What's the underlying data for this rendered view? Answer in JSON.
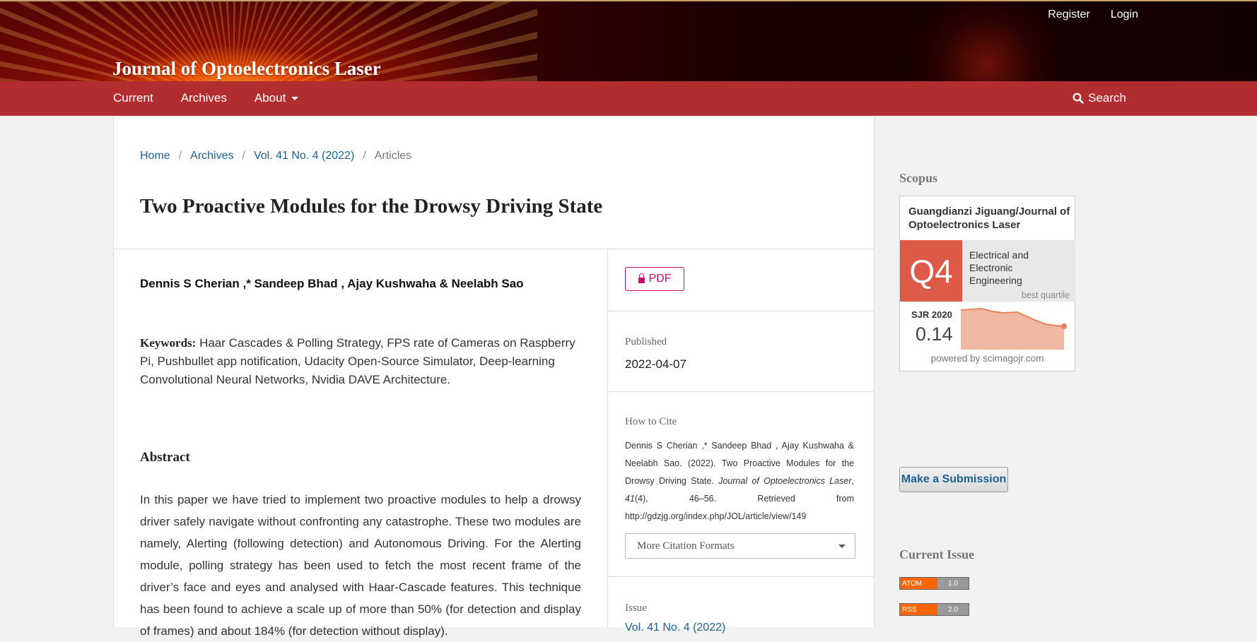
{
  "header": {
    "site_title": "Journal of Optoelectronics Laser",
    "user_nav": {
      "register": "Register",
      "login": "Login"
    }
  },
  "nav": {
    "items": [
      {
        "label": "Current"
      },
      {
        "label": "Archives"
      },
      {
        "label": "About"
      }
    ],
    "search": "Search"
  },
  "breadcrumb": {
    "home": "Home",
    "archives": "Archives",
    "issue": "Vol. 41 No. 4 (2022)",
    "current": "Articles",
    "separator": "/"
  },
  "article": {
    "title": "Two Proactive Modules for the Drowsy Driving State",
    "authors": "Dennis S Cherian ,* Sandeep Bhad , Ajay Kushwaha & Neelabh Sao",
    "keywords_label": "Keywords:",
    "keywords": "Haar Cascades & Polling Strategy, FPS rate of Cameras on Raspberry Pi, Pushbullet app notification, Udacity Open-Source Simulator, Deep-learning Convolutional Neural Networks, Nvidia DAVE Architecture.",
    "abstract_heading": "Abstract",
    "abstract": "In this paper we have tried to implement two proactive modules to help a drowsy driver safely navigate without confronting any catastrophe. These two modules are namely, Alerting (following detection) and Autonomous Driving. For the Alerting module, polling strategy has been used to fetch the most recent frame of the driver’s face and eyes and analysed with Haar-Cascade features. This technique has been found to achieve a scale up of more than 50% (for detection and display of frames) and about 184% (for detection without display)."
  },
  "details": {
    "pdf_label": "PDF",
    "published_label": "Published",
    "published_date": "2022-04-07",
    "cite_label": "How to Cite",
    "citation": {
      "authors": "Dennis S Cherian ,* Sandeep Bhad , Ajay Kushwaha & Neelabh Sao.",
      "year": "(2022).",
      "title": "Two Proactive Modules for the Drowsy Driving State.",
      "journal": "Journal of Optoelectronics Laser",
      "volume": "41",
      "issue": "(4),",
      "pages": "46–56.",
      "retrieved": "Retrieved from http://gdzjg.org/index.php/JOL/article/view/149"
    },
    "citation_formats": "More Citation Formats",
    "issue_label": "Issue",
    "issue_link": "Vol. 41 No. 4 (2022)"
  },
  "sidebar": {
    "scopus_heading": "Scopus",
    "sjr": {
      "journal": "Guangdianzi Jiguang/Journal of Optoelectronics Laser",
      "quartile": "Q4",
      "category": "Electrical and Electronic Engineering",
      "best": "best quartile",
      "year": "SJR 2020",
      "value": "0.14",
      "powered": "powered by scimagojr.com",
      "colors": {
        "quartile": "#de5a48",
        "trend": "#f0b8a0",
        "trend_line": "#e8825a"
      }
    },
    "submit": "Make a Submission",
    "current_issue_heading": "Current Issue",
    "feeds": [
      {
        "type": "ATOM",
        "version": "1.0"
      },
      {
        "type": "RSS",
        "version": "2.0"
      }
    ]
  },
  "colors": {
    "nav": "#b22d2f",
    "link": "#1e6292",
    "pdf": "#d00a6c"
  }
}
